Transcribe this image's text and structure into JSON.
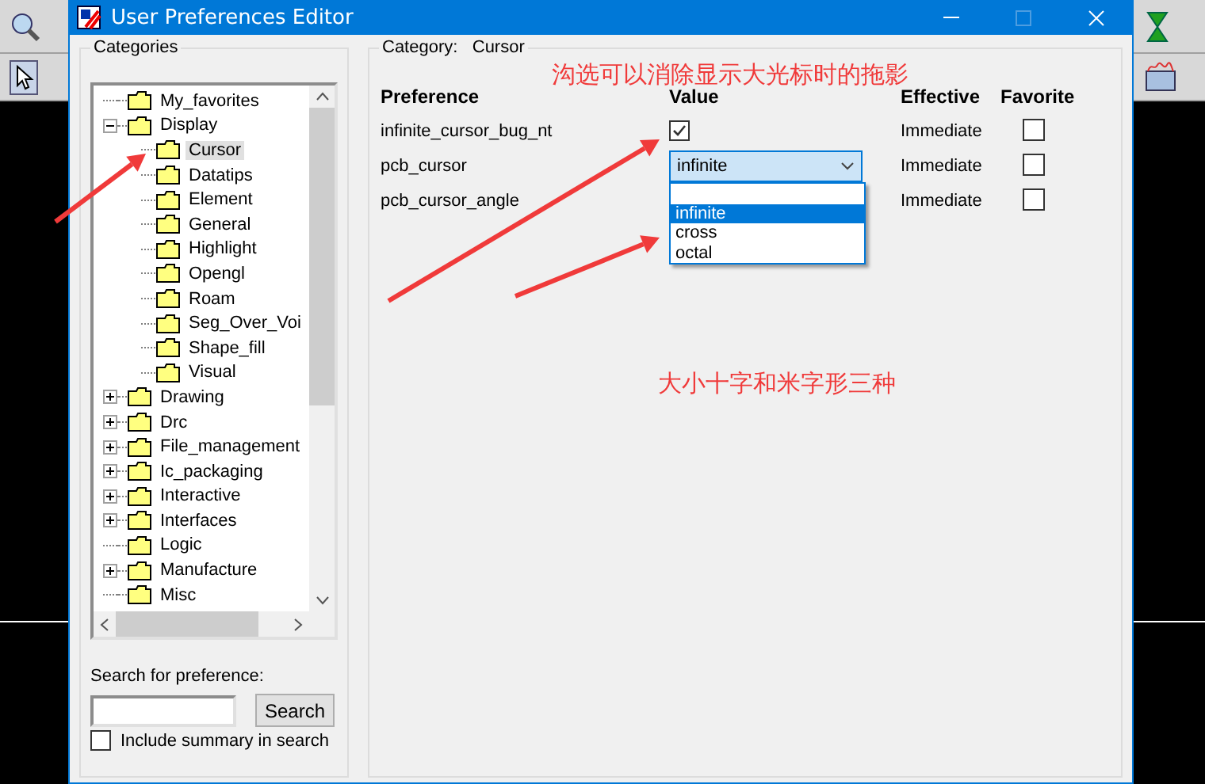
{
  "window": {
    "title": "User Preferences Editor",
    "controls": [
      {
        "kind": "minimize",
        "disabled": false
      },
      {
        "kind": "maximize",
        "disabled": true
      },
      {
        "kind": "close",
        "disabled": false
      }
    ]
  },
  "categories": {
    "title": "Categories",
    "tree": [
      {
        "label": "My_favorites",
        "kind": "leaf",
        "selected": false
      },
      {
        "label": "Display",
        "kind": "group",
        "expanded": true,
        "selected": false,
        "children": [
          {
            "label": "Cursor",
            "selected": true
          },
          {
            "label": "Datatips",
            "selected": false
          },
          {
            "label": "Element",
            "selected": false
          },
          {
            "label": "General",
            "selected": false
          },
          {
            "label": "Highlight",
            "selected": false
          },
          {
            "label": "Opengl",
            "selected": false
          },
          {
            "label": "Roam",
            "selected": false
          },
          {
            "label": "Seg_Over_Voi",
            "selected": false
          },
          {
            "label": "Shape_fill",
            "selected": false
          },
          {
            "label": "Visual",
            "selected": false
          }
        ]
      },
      {
        "label": "Drawing",
        "kind": "group",
        "expanded": false,
        "selected": false
      },
      {
        "label": "Drc",
        "kind": "group",
        "expanded": false,
        "selected": false
      },
      {
        "label": "File_management",
        "kind": "group",
        "expanded": false,
        "selected": false
      },
      {
        "label": "Ic_packaging",
        "kind": "group",
        "expanded": false,
        "selected": false
      },
      {
        "label": "Interactive",
        "kind": "group",
        "expanded": false,
        "selected": false
      },
      {
        "label": "Interfaces",
        "kind": "group",
        "expanded": false,
        "selected": false
      },
      {
        "label": "Logic",
        "kind": "leaf",
        "selected": false
      },
      {
        "label": "Manufacture",
        "kind": "group",
        "expanded": false,
        "selected": false
      },
      {
        "label": "Misc",
        "kind": "leaf",
        "selected": false
      }
    ]
  },
  "search": {
    "label": "Search for preference:",
    "button": "Search",
    "include_summary": {
      "label": "Include summary in search",
      "checked": false
    }
  },
  "preferences": {
    "category_label": "Category:",
    "category": "Cursor",
    "columns": [
      "Preference",
      "Value",
      "Effective",
      "Favorite"
    ],
    "rows": [
      {
        "name": "infinite_cursor_bug_nt",
        "kind": "checkbox",
        "checked": true,
        "effective": "Immediate",
        "favorite": false
      },
      {
        "name": "pcb_cursor",
        "kind": "select",
        "value": "infinite",
        "open": true,
        "options": [
          {
            "kind": "blank",
            "selected": false
          },
          {
            "kind": "text",
            "label": "infinite",
            "selected": true
          },
          {
            "kind": "text",
            "label": "cross",
            "selected": false
          },
          {
            "kind": "text",
            "label": "octal",
            "selected": false
          }
        ],
        "effective": "Immediate",
        "favorite": false
      },
      {
        "name": "pcb_cursor_angle",
        "kind": "blank",
        "effective": "Immediate",
        "favorite": false
      }
    ]
  },
  "annotations": [
    "沟选可以消除显示大光标时的拖影",
    "大小十字和米字形三种"
  ]
}
